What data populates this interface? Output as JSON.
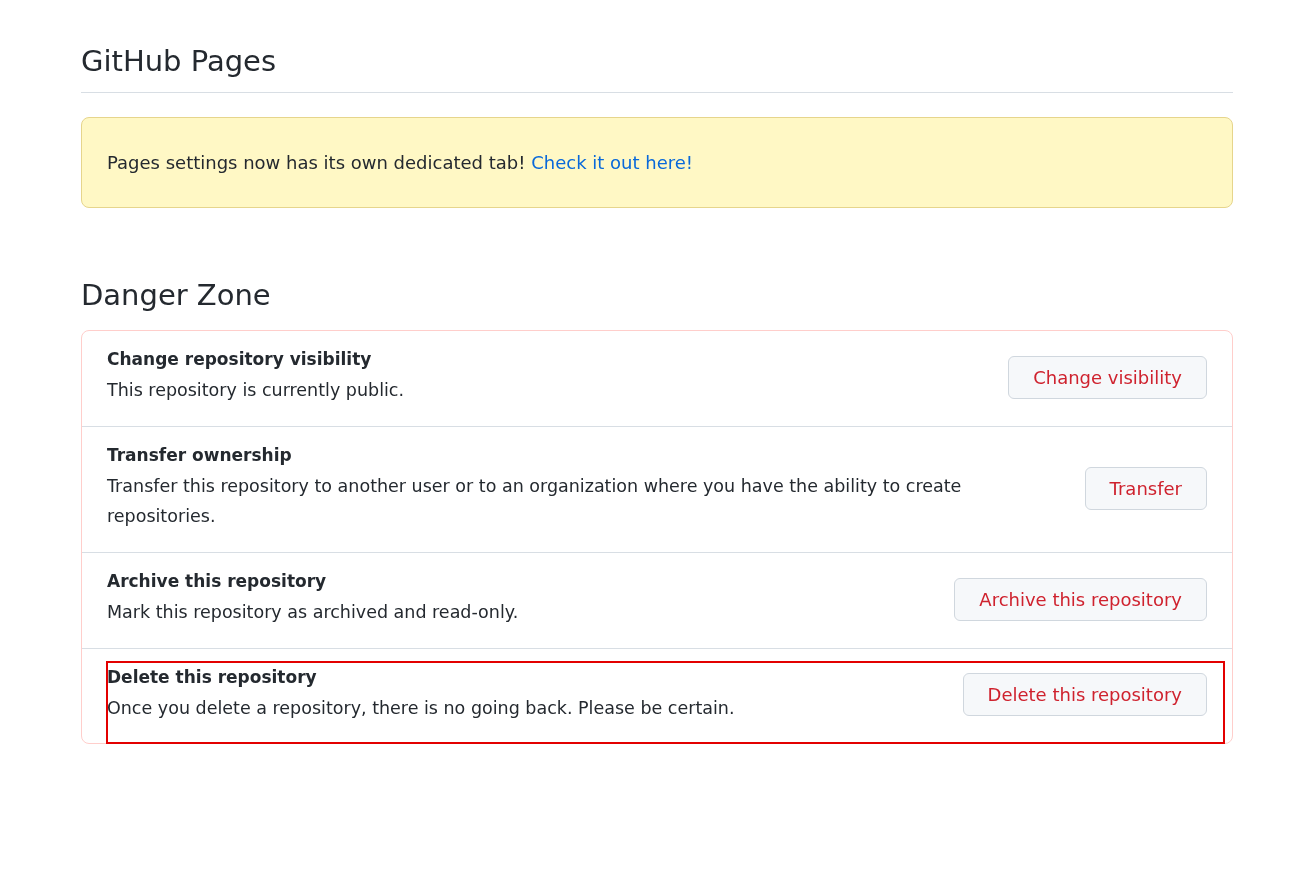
{
  "pages_section": {
    "title": "GitHub Pages",
    "notice": {
      "text": "Pages settings now has its own dedicated tab!",
      "link": "Check it out here!"
    }
  },
  "danger_zone": {
    "title": "Danger Zone",
    "items": [
      {
        "title": "Change repository visibility",
        "description": "This repository is currently public.",
        "button": "Change visibility",
        "highlighted": false
      },
      {
        "title": "Transfer ownership",
        "description": "Transfer this repository to another user or to an organization where you have the ability to create repositories.",
        "button": "Transfer",
        "highlighted": false
      },
      {
        "title": "Archive this repository",
        "description": "Mark this repository as archived and read-only.",
        "button": "Archive this repository",
        "highlighted": false
      },
      {
        "title": "Delete this repository",
        "description": "Once you delete a repository, there is no going back. Please be certain.",
        "button": "Delete this repository",
        "highlighted": true
      }
    ]
  }
}
